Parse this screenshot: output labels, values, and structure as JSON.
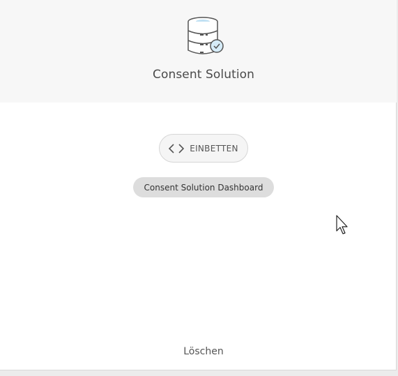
{
  "card": {
    "title": "Consent Solution",
    "icon": "database-check-icon"
  },
  "actions": {
    "embed_label": "EINBETTEN",
    "embed_icon": "code-icon",
    "dashboard_chip": "Consent Solution Dashboard",
    "delete_label": "Löschen"
  },
  "colors": {
    "header_bg": "#f7f7f7",
    "card_bg": "#ffffff",
    "chip_bg": "#dddddd",
    "check_badge": "#d6ecf8"
  }
}
